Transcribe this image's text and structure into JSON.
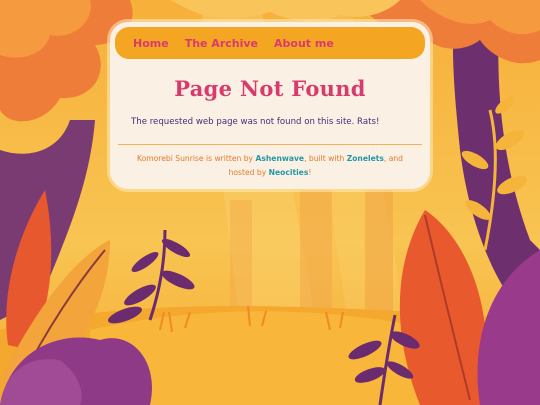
{
  "nav": {
    "items": [
      {
        "label": "Home"
      },
      {
        "label": "The Archive"
      },
      {
        "label": "About me"
      }
    ]
  },
  "page": {
    "title": "Page Not Found",
    "message": "The requested web page was not found on this site. Rats!"
  },
  "footer": {
    "text1": "Komorebi Sunrise is written by ",
    "author": "Ashenwave",
    "text2": ", built with ",
    "tool": "Zonelets",
    "text3": ", and hosted by ",
    "host": "Neocities",
    "text4": "!"
  },
  "colors": {
    "accent_pink": "#d93a6e",
    "nav_bg": "#f4a623",
    "card_bg": "#faf0e3",
    "link_teal": "#2597a6",
    "footer_orange": "#e47a2c",
    "text_purple": "#4a2a7a"
  },
  "icons": [
    "forest-background-illustration"
  ]
}
